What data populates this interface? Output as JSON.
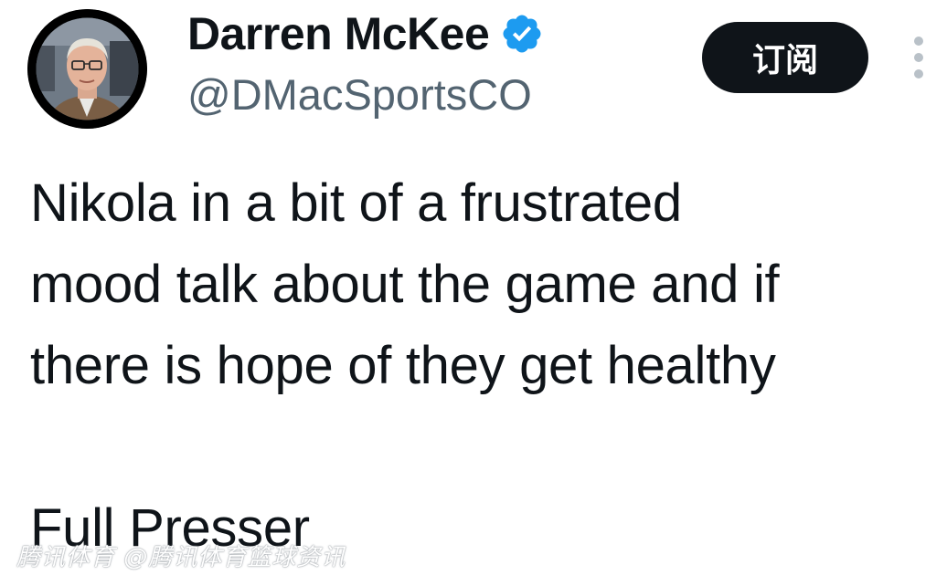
{
  "author": {
    "display_name": "Darren McKee",
    "handle": "@DMacSportsCO",
    "verified": true,
    "verified_color": "#1d9bf0",
    "avatar": "headshot-photo"
  },
  "actions": {
    "subscribe_label": "订阅",
    "more_icon": "vertical-ellipsis-icon"
  },
  "tweet": {
    "text": "Nikola in a bit of a frustrated\nmood talk about the game and if\nthere is hope of they get healthy\n\nFull Presser"
  },
  "watermark": {
    "text": "腾讯体育 @腾讯体育篮球资讯"
  }
}
